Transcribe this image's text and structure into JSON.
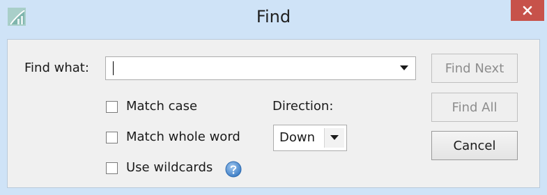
{
  "window": {
    "title": "Find",
    "title_bar_color": "#cfe3f7",
    "close_color": "#c7524a"
  },
  "find": {
    "label": "Find what:",
    "value": "",
    "placeholder": ""
  },
  "options": {
    "match_case": {
      "label": "Match case",
      "checked": false
    },
    "match_whole_word": {
      "label": "Match whole word",
      "checked": false
    },
    "use_wildcards": {
      "label": "Use wildcards",
      "checked": false
    }
  },
  "direction": {
    "label": "Direction:",
    "value": "Down"
  },
  "buttons": {
    "find_next": "Find Next",
    "find_all": "Find All",
    "cancel": "Cancel"
  },
  "icons": {
    "app": "app-icon",
    "close": "close-icon",
    "dropdown": "chevron-down-icon",
    "help": "help-icon"
  }
}
